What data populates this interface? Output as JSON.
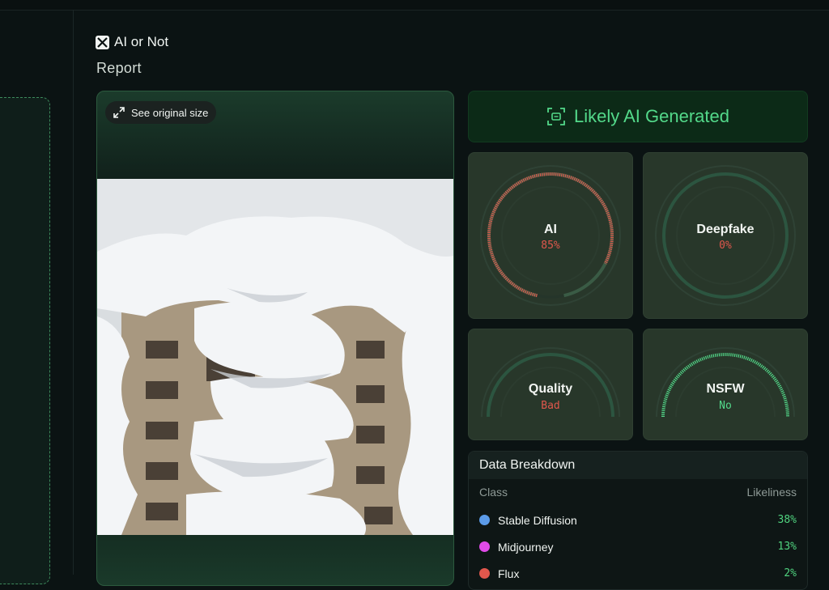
{
  "brand": {
    "name": "AI or Not"
  },
  "page": {
    "title": "Report"
  },
  "image_card": {
    "original_size_label": "See original size"
  },
  "verdict": {
    "label": "Likely AI Generated",
    "color": "#53d98a"
  },
  "gauges": {
    "ai": {
      "label": "AI",
      "value": "85%",
      "fraction": 0.85,
      "color": "#e0574c"
    },
    "deepfake": {
      "label": "Deepfake",
      "value": "0%",
      "fraction": 0.0,
      "color": "#e0574c"
    },
    "quality": {
      "label": "Quality",
      "value": "Bad",
      "fraction": 0.0,
      "color": "#e0574c"
    },
    "nsfw": {
      "label": "NSFW",
      "value": "No",
      "fraction": 1.0,
      "color": "#53d98a"
    }
  },
  "breakdown": {
    "title": "Data Breakdown",
    "col_class": "Class",
    "col_likeliness": "Likeliness",
    "rows": [
      {
        "name": "Stable Diffusion",
        "pct": "38%",
        "color": "#5b9be8"
      },
      {
        "name": "Midjourney",
        "pct": "13%",
        "color": "#e04be8"
      },
      {
        "name": "Flux",
        "pct": "2%",
        "color": "#e0574c"
      }
    ]
  }
}
